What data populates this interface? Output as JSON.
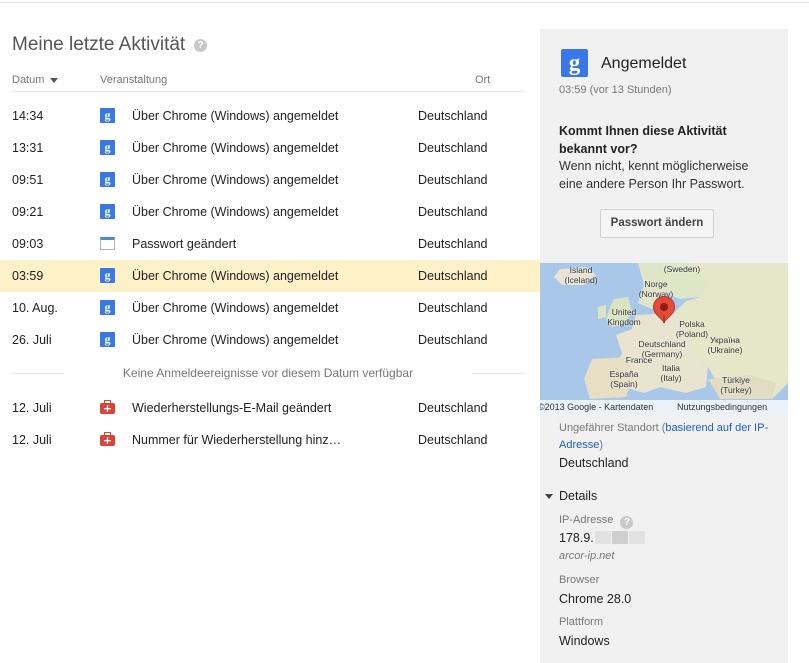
{
  "page": {
    "title": "Meine letzte Aktivität",
    "help_icon": "?"
  },
  "table": {
    "col_date": "Datum",
    "col_event": "Veranstaltung",
    "col_location": "Ort",
    "rows": [
      {
        "time": "14:34",
        "icon": "google-icon",
        "event": "Über Chrome (Windows) angemeldet",
        "location": "Deutschland"
      },
      {
        "time": "13:31",
        "icon": "google-icon",
        "event": "Über Chrome (Windows) angemeldet",
        "location": "Deutschland"
      },
      {
        "time": "09:51",
        "icon": "google-icon",
        "event": "Über Chrome (Windows) angemeldet",
        "location": "Deutschland"
      },
      {
        "time": "09:21",
        "icon": "google-icon",
        "event": "Über Chrome (Windows) angemeldet",
        "location": "Deutschland"
      },
      {
        "time": "09:03",
        "icon": "password-icon",
        "event": "Passwort geändert",
        "location": "Deutschland"
      },
      {
        "time": "03:59",
        "icon": "google-icon",
        "event": "Über Chrome (Windows) angemeldet",
        "location": "Deutschland",
        "selected": true
      },
      {
        "time": "10. Aug.",
        "icon": "google-icon",
        "event": "Über Chrome (Windows) angemeldet",
        "location": "Deutschland"
      },
      {
        "time": "26. Juli",
        "icon": "google-icon",
        "event": "Über Chrome (Windows) angemeldet",
        "location": "Deutschland"
      }
    ],
    "separator": "Keine Anmeldeereignisse vor diesem Datum verfügbar",
    "rows_after": [
      {
        "time": "12. Juli",
        "icon": "recovery-icon",
        "event": "Wiederherstellungs-E-Mail geändert",
        "location": "Deutschland"
      },
      {
        "time": "12. Juli",
        "icon": "recovery-icon",
        "event": "Nummer für Wiederherstellung hinz…",
        "location": "Deutschland"
      }
    ]
  },
  "panel": {
    "title": "Angemeldet",
    "time": "03:59 (vor 13 Stunden)",
    "question": "Kommt Ihnen diese Aktivität bekannt vor?",
    "question_sub": "Wenn nicht, kennt möglicherweise eine andere Person Ihr Passwort.",
    "button": "Passwort ändern",
    "map": {
      "labels": {
        "island": "Island\n(Iceland)",
        "sweden": "(Sweden)",
        "norway": "Norge\n(Norway)",
        "uk": "United\nKingdom",
        "poland": "Polska\n(Poland)",
        "germany": "Deutschland\n(Germany)",
        "ukraine": "Україна\n(Ukraine)",
        "france": "France",
        "italia": "Italia\n(Italy)",
        "spain": "España\n(Spain)",
        "turkey": "Türkiye\n(Turkey)"
      },
      "copyright": "©2013 Google - Kartendaten",
      "terms": "Nutzungsbedingungen"
    },
    "location_label": "Ungefährer Standort (",
    "location_link": "basierend auf der IP-Adresse",
    "location_label_end": ")",
    "location_value": "Deutschland",
    "details": "Details",
    "ip_label": "IP-Adresse",
    "ip_value": "178.9.",
    "ip_host": "arcor-ip.net",
    "browser_label": "Browser",
    "browser_value": "Chrome 28.0",
    "platform_label": "Plattform",
    "platform_value": "Windows"
  },
  "colors": {
    "selected_row": "#fdf1c8",
    "panel_bg": "#f1f1f1",
    "google_blue": "#3b78e7",
    "link": "#1a5fc4"
  }
}
